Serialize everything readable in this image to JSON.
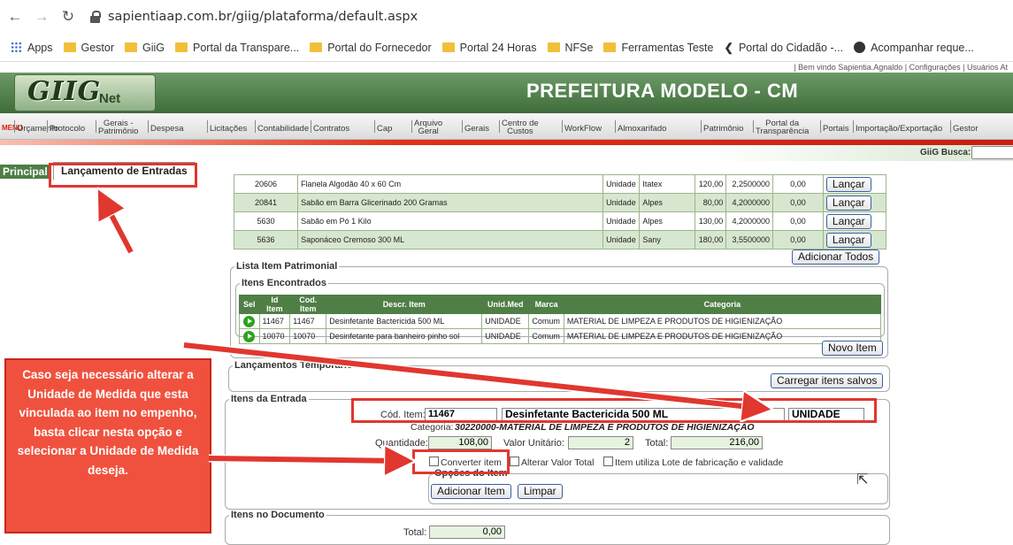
{
  "browser": {
    "url": "sapientiaap.com.br/giig/plataforma/default.aspx",
    "bookmarks": [
      "Apps",
      "Gestor",
      "GiiG",
      "Portal da Transpare...",
      "Portal do Fornecedor",
      "Portal 24 Horas",
      "NFSe",
      "Ferramentas Teste",
      "Portal do Cidadão -...",
      "Acompanhar reque..."
    ]
  },
  "app": {
    "top_info": "|  Bem vindo Sapientia.Agnaldo   |  Configurações   |  Usuários At",
    "logo_main": "GIIG",
    "logo_sub": "Net",
    "city": "PREFEITURA MODELO - CM",
    "menu_word": "MENU",
    "menu": [
      "Orçamento",
      "Protocolo",
      "Gerais -\nPatrimônio",
      "Despesa",
      "Licitações",
      "Contabilidade",
      "Contratos",
      "Cap",
      "Arquivo\nGeral",
      "Gerais",
      "Centro de\nCustos",
      "WorkFlow",
      "Almoxarifado",
      "Patrimônio",
      "Portal da\nTransparência",
      "Portais",
      "Importação/Exportação",
      "Gestor"
    ],
    "busca_label": "GiiG Busca:"
  },
  "tabs": {
    "principal": "Principal",
    "lancamento": "Lançamento de Entradas"
  },
  "top_items": [
    {
      "code": "20606",
      "desc": "Flanela Algodão 40 x 60 Cm",
      "unit": "Unidade",
      "brand": "Itatex",
      "qty": "120,00",
      "price": "2,2500000",
      "val": "0,00",
      "btn": "Lançar"
    },
    {
      "code": "20841",
      "desc": "Sabão em Barra Glicerinado 200 Gramas",
      "unit": "Unidade",
      "brand": "Alpes",
      "qty": "80,00",
      "price": "4,2000000",
      "val": "0,00",
      "btn": "Lançar"
    },
    {
      "code": "5630",
      "desc": "Sabão em Pó 1 Kilo",
      "unit": "Unidade",
      "brand": "Alpes",
      "qty": "130,00",
      "price": "4,2000000",
      "val": "0,00",
      "btn": "Lançar"
    },
    {
      "code": "5636",
      "desc": "Saponáceo Cremoso 300 ML",
      "unit": "Unidade",
      "brand": "Sany",
      "qty": "180,00",
      "price": "3,5500000",
      "val": "0,00",
      "btn": "Lançar"
    }
  ],
  "add_all": "Adicionar Todos",
  "patrimonial": {
    "legend": "Lista Item Patrimonial",
    "inner_legend": "Itens Encontrados",
    "headers": [
      "Sel",
      "Id Item",
      "Cod. Item",
      "Descr. Item",
      "Unid.Med",
      "Marca",
      "Categoria"
    ],
    "rows": [
      {
        "id": "11467",
        "cod": "11467",
        "desc": "Desinfetante Bactericida 500 ML",
        "unit": "UNIDADE",
        "brand": "Comum",
        "cat": "MATERIAL DE LIMPEZA E PRODUTOS DE HIGIENIZAÇÃO"
      },
      {
        "id": "10070",
        "cod": "10070",
        "desc": "Desinfetante para banheiro pinho sol",
        "unit": "UNIDADE",
        "brand": "Comum",
        "cat": "MATERIAL DE LIMPEZA E PRODUTOS DE HIGIENIZAÇÃO"
      }
    ],
    "novo_item": "Novo Item"
  },
  "temporarios": {
    "legend": "Lançamentos Temporários",
    "button": "Carregar itens salvos"
  },
  "entrada": {
    "legend": "Itens da Entrada",
    "cod_label": "Cód. Item:",
    "cod_value": "11467",
    "desc_value": "Desinfetante Bactericida 500 ML",
    "unit_value": "UNIDADE",
    "categoria_label": "Categoria:",
    "categoria_value": "30220000-MATERIAL DE LIMPEZA E PRODUTOS DE HIGIENIZAÇÃO",
    "qtd_label": "Quantidade:",
    "qtd_value": "108,00",
    "vu_label": "Valor Unitário:",
    "vu_value": "2",
    "total_label": "Total:",
    "total_value": "216,00",
    "chk_converter": "Converter item",
    "chk_alterar": "Alterar Valor Total",
    "chk_lote": "Item utiliza Lote de fabricação e validade",
    "opcoes_legend": "Opções do Item",
    "btn_add": "Adicionar Item",
    "btn_limpar": "Limpar"
  },
  "documento": {
    "legend": "Itens no Documento",
    "total_label": "Total:",
    "total_value": "0,00"
  },
  "callout": "Caso seja necessário alterar a Unidade de Medida que esta vinculada ao item no empenho, basta clicar nesta opção e selecionar a Unidade de Medida deseja.",
  "colors": {
    "accent": "#e0372f",
    "green_header": "#4f7e46",
    "callout_bg": "#f0513e"
  }
}
